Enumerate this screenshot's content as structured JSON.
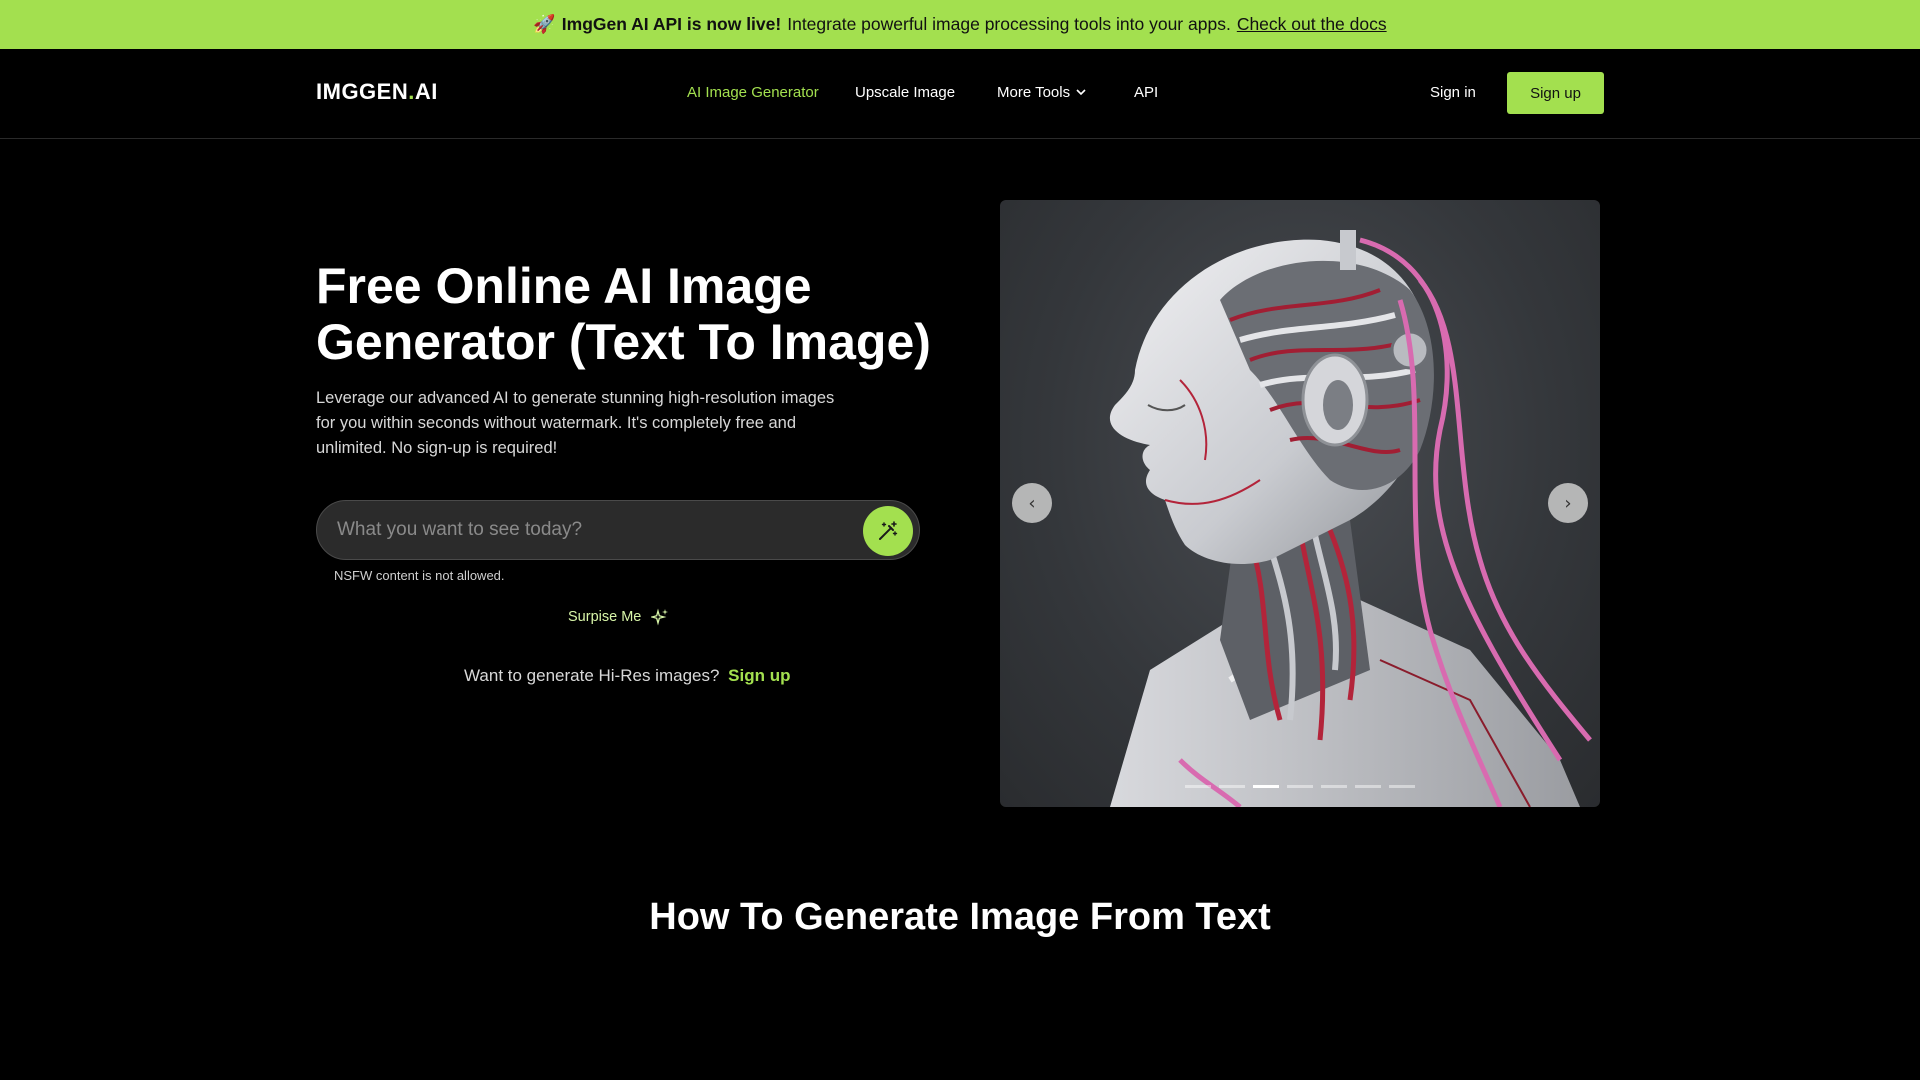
{
  "announcement": {
    "icon": "rocket-emoji",
    "emoji": "🚀",
    "headline": "ImgGen AI API is now live!",
    "text": "Integrate powerful image processing tools into your apps.",
    "link": "Check out the docs"
  },
  "header": {
    "logo_main": "IMGGEN",
    "logo_dot": ".",
    "logo_suffix": "AI",
    "nav": [
      {
        "label": "AI Image Generator",
        "active": true
      },
      {
        "label": "Upscale Image",
        "active": false
      },
      {
        "label": "More Tools",
        "active": false,
        "icon": "chevron-down-icon"
      },
      {
        "label": "API",
        "active": false
      }
    ],
    "signin": "Sign in",
    "signup": "Sign up"
  },
  "hero": {
    "title": "Free Online AI Image Generator (Text To Image)",
    "description": "Leverage our advanced AI to generate stunning high-resolution images for you within seconds without watermark. It's completely free and unlimited. No sign-up is required!",
    "prompt_placeholder": "What you want to see today?",
    "prompt_value": "",
    "generate_icon": "magic-wand-icon",
    "nsfw_note": "NSFW content is not allowed.",
    "surprise_label": "Surpise Me",
    "surprise_icon": "sparkles-icon",
    "hires_text": "Want to generate Hi-Res images?",
    "hires_link": "Sign up"
  },
  "carousel": {
    "prev": "‹",
    "next": "›",
    "slides": 7,
    "active_slide": 2
  },
  "section": {
    "title": "How To Generate Image From Text"
  },
  "colors": {
    "accent": "#a3e04f",
    "background": "#000000"
  }
}
